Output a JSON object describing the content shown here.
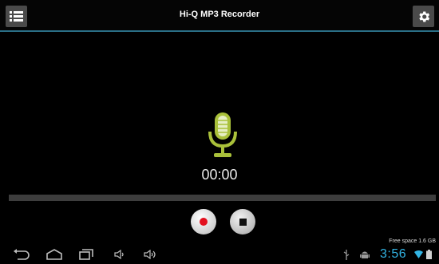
{
  "app": {
    "title": "Hi-Q MP3 Recorder"
  },
  "recorder": {
    "timer": "00:00",
    "progress": 0,
    "mic_color": "#a9c03a"
  },
  "status": {
    "free_space": "Free space 1.6 GB",
    "clock": "3:56",
    "accent_color": "#33b5e5"
  },
  "icons": {
    "menu": "menu-icon",
    "settings": "gear-icon",
    "mic": "microphone-icon",
    "record": "record-icon",
    "stop": "stop-icon",
    "back": "back-icon",
    "home": "home-icon",
    "recents": "recent-apps-icon",
    "vol_down": "volume-down-icon",
    "vol_up": "volume-up-icon",
    "usb": "usb-icon",
    "android": "android-icon",
    "wifi": "wifi-icon",
    "battery": "battery-icon"
  }
}
